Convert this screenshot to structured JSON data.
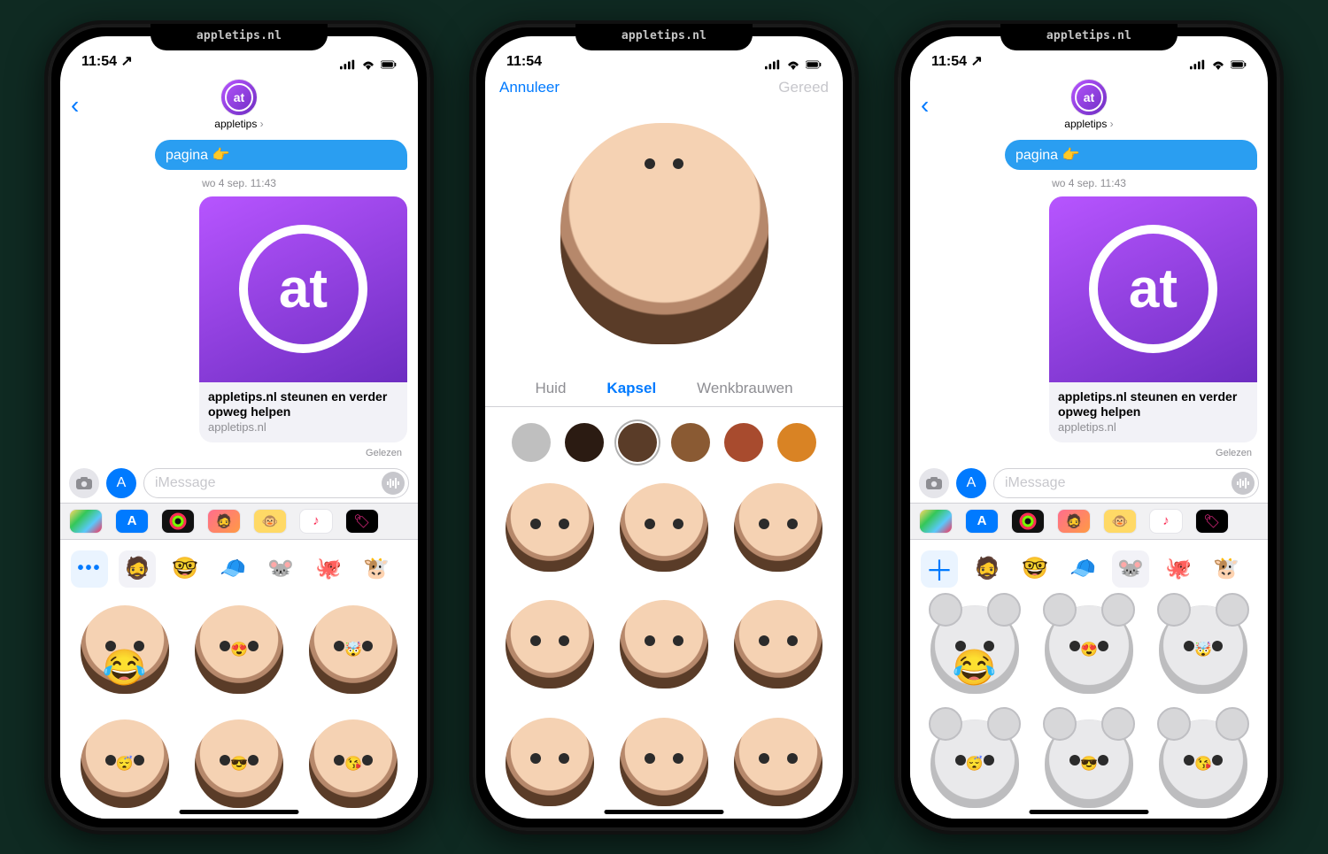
{
  "brand_overlay": "appletips.nl",
  "status": {
    "time": "11:54",
    "location_arrow": "↗"
  },
  "chat": {
    "contact": "appletips",
    "bubble_out": "pagina 👉",
    "timestamp": "wo 4 sep. 11:43",
    "link_title": "appletips.nl steunen en verder opweg helpen",
    "link_domain": "appletips.nl",
    "read_receipt": "Gelezen",
    "input_placeholder": "iMessage"
  },
  "apps": {
    "photos": "⦿",
    "store": "A",
    "rings": "◎",
    "memoji": "🧔",
    "animoji": "🐵",
    "music": "♪",
    "black": "🏷"
  },
  "drawerA": {
    "more": "•••",
    "top_row": [
      "🧔",
      "🤓",
      "🧢",
      "🐭",
      "🐙",
      "🐮"
    ],
    "stickers": [
      "😂",
      "😍",
      "🤯",
      "😴",
      "😎",
      "😘"
    ]
  },
  "drawerB": {
    "plus": "＋",
    "top_row": [
      "🧔",
      "🤓",
      "🧢",
      "🐭",
      "🐙",
      "🐮"
    ],
    "stickers": [
      "😂",
      "😍",
      "🤯",
      "😴",
      "😎",
      "😘"
    ]
  },
  "editor": {
    "cancel": "Annuleer",
    "done": "Gereed",
    "tabs": {
      "skin": "Huid",
      "hair": "Kapsel",
      "brows": "Wenkbrauwen"
    },
    "colors": [
      "#bfbfbf",
      "#2b1b12",
      "#5a3c28",
      "#8a5a33",
      "#a84b2e",
      "#d98324"
    ],
    "selected_color_index": 2
  }
}
